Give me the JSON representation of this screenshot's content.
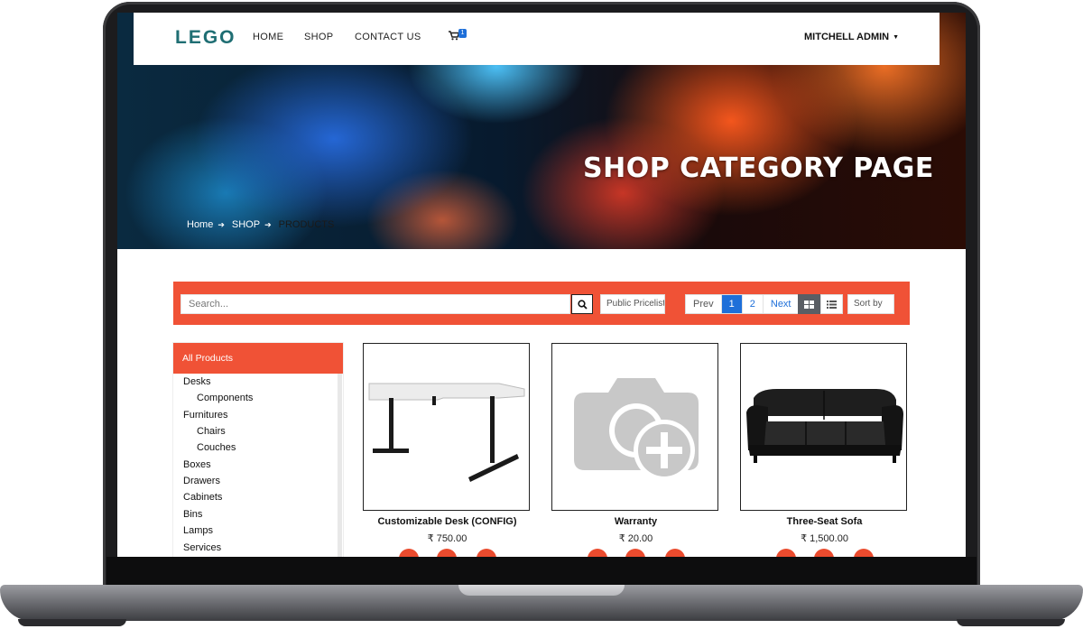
{
  "navbar": {
    "logo": "LEGO",
    "links": [
      "HOME",
      "SHOP",
      "CONTACT US"
    ],
    "cart_count": "1",
    "user": "MITCHELL ADMIN"
  },
  "hero": {
    "title": "SHOP CATEGORY PAGE",
    "breadcrumb": [
      "Home",
      "SHOP",
      "PRODUCTS"
    ]
  },
  "toolbar": {
    "search_placeholder": "Search...",
    "pricelist": "Public Pricelist",
    "pager": {
      "prev": "Prev",
      "pages": [
        "1",
        "2"
      ],
      "active_page": "1",
      "next": "Next"
    },
    "sort": "Sort by"
  },
  "sidebar": {
    "header": "All Products",
    "categories": [
      {
        "label": "Desks",
        "level": 0
      },
      {
        "label": "Components",
        "level": 1
      },
      {
        "label": "Furnitures",
        "level": 0
      },
      {
        "label": "Chairs",
        "level": 1
      },
      {
        "label": "Couches",
        "level": 1
      },
      {
        "label": "Boxes",
        "level": 0
      },
      {
        "label": "Drawers",
        "level": 0
      },
      {
        "label": "Cabinets",
        "level": 0
      },
      {
        "label": "Bins",
        "level": 0
      },
      {
        "label": "Lamps",
        "level": 0
      },
      {
        "label": "Services",
        "level": 0
      }
    ]
  },
  "products": [
    {
      "name": "Customizable Desk (CONFIG)",
      "price": "₹ 750.00",
      "image": "desk"
    },
    {
      "name": "Warranty",
      "price": "₹ 20.00",
      "image": "placeholder-camera-plus"
    },
    {
      "name": "Three-Seat Sofa",
      "price": "₹ 1,500.00",
      "image": "sofa"
    }
  ],
  "colors": {
    "accent": "#f05236",
    "logo": "#1f6e73",
    "link_blue": "#1e6fd9"
  }
}
